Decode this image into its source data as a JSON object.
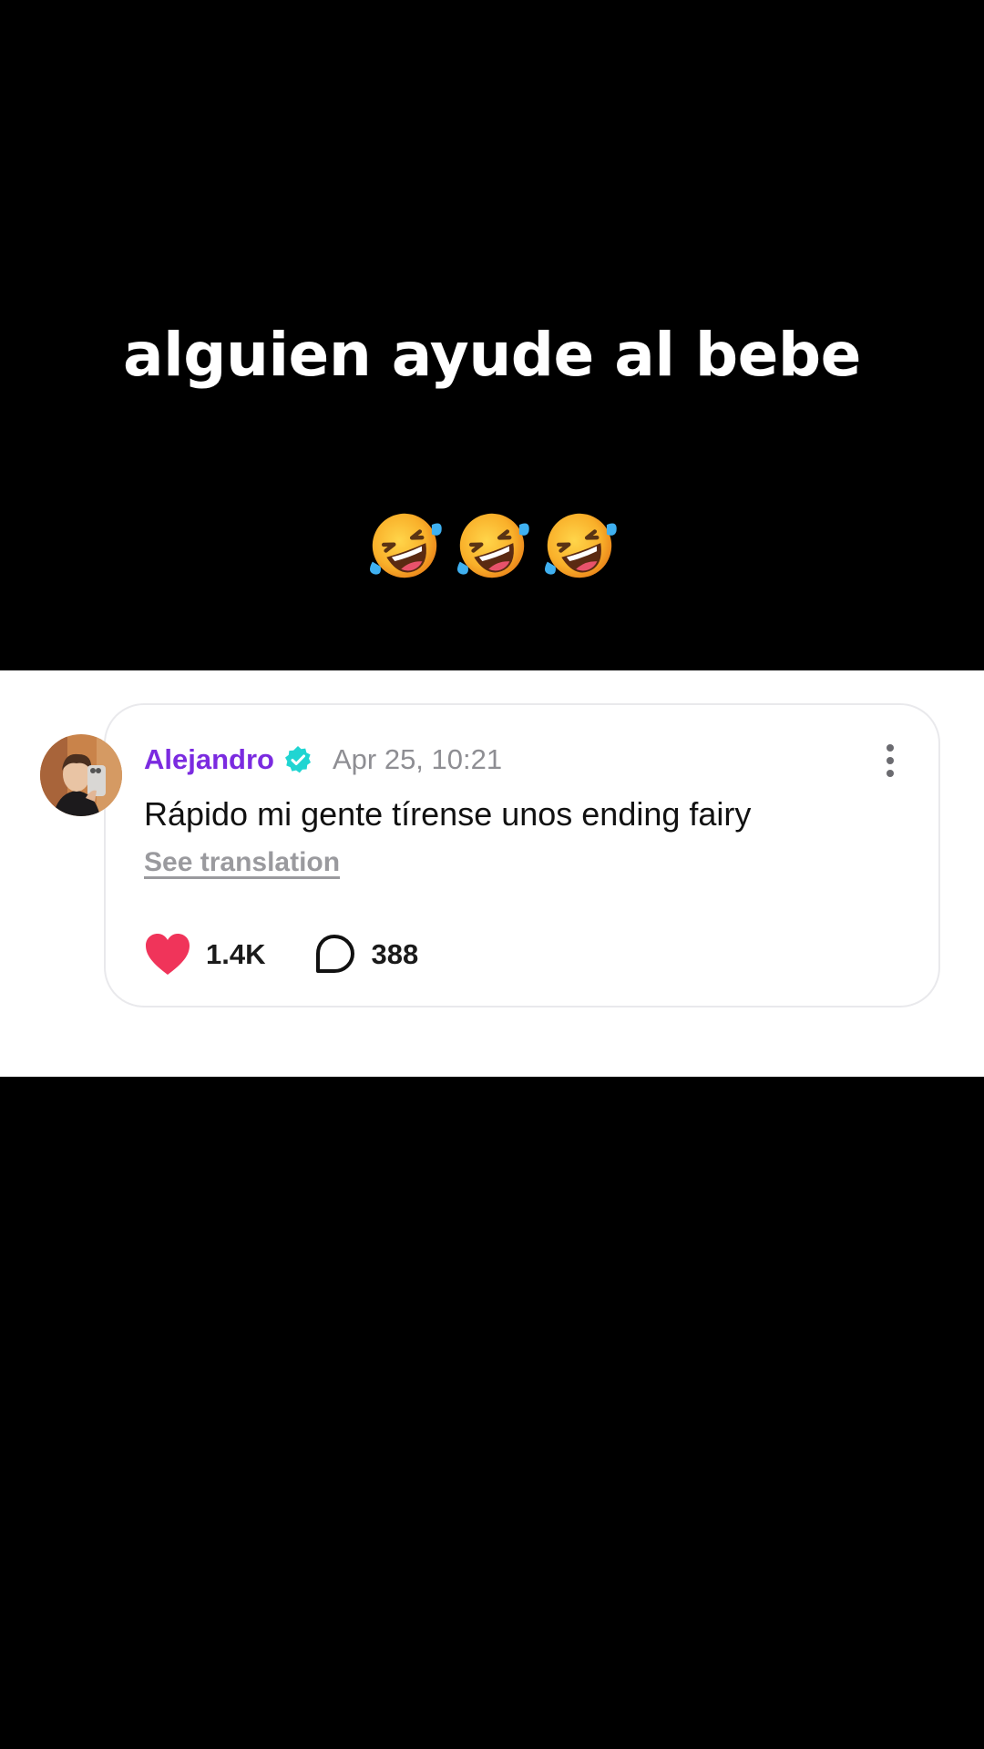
{
  "overlay": {
    "caption": "alguien ayude al bebe",
    "emojis": [
      "rolling-on-floor-laughing",
      "rolling-on-floor-laughing",
      "rolling-on-floor-laughing"
    ]
  },
  "comment": {
    "username": "Alejandro",
    "verified": true,
    "timestamp": "Apr 25, 10:21",
    "text": "Rápido mi gente tírense unos ending fairy",
    "see_translation": "See translation",
    "likes": "1.4K",
    "replies": "388",
    "username_color": "#7b2be0",
    "verified_color": "#20d5d2",
    "heart_color": "#f0345a",
    "more_icon": "more-vertical-icon"
  }
}
